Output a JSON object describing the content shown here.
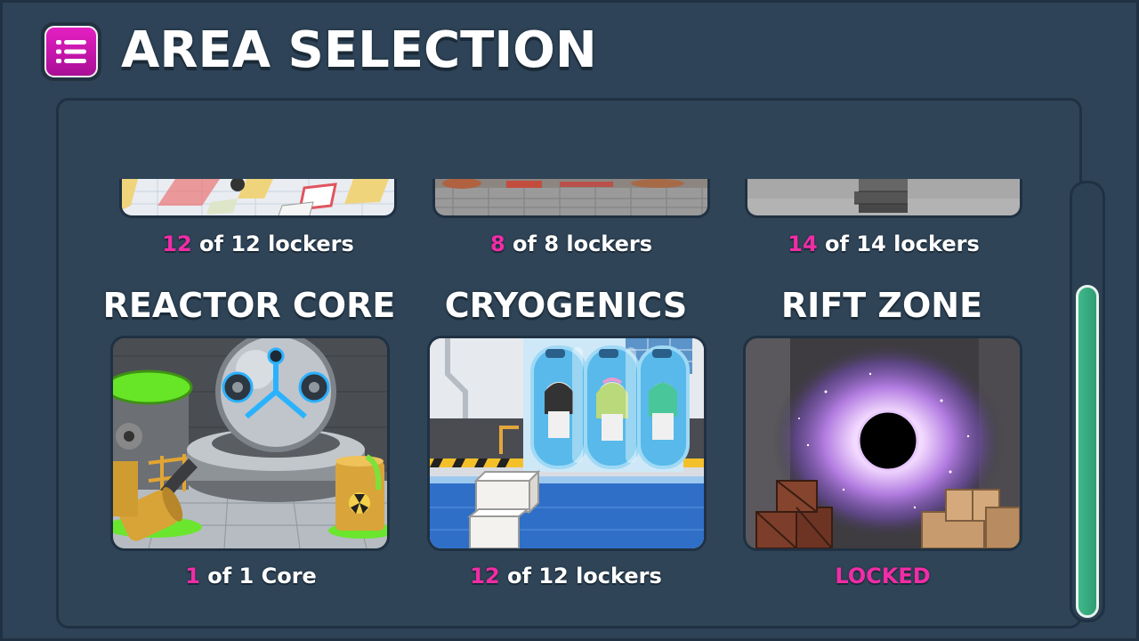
{
  "header": {
    "title": "AREA SELECTION",
    "menu_icon": "list-menu-icon"
  },
  "colors": {
    "background": "#2e4357",
    "accent_pink": "#f12ca6",
    "menu_button": "#d318b6",
    "scroll_thumb": "#3fb88a"
  },
  "partial_row": [
    {
      "count": "12",
      "suffix": " of 12 lockers"
    },
    {
      "count": "8",
      "suffix": " of 8 lockers"
    },
    {
      "count": "14",
      "suffix": " of 14 lockers"
    }
  ],
  "areas": [
    {
      "name": "REACTOR CORE",
      "count": "1",
      "suffix": " of 1 Core",
      "icon": "reactor-core-scene"
    },
    {
      "name": "CRYOGENICS",
      "count": "12",
      "suffix": " of 12 lockers",
      "icon": "cryogenics-scene"
    },
    {
      "name": "RIFT ZONE",
      "status": "LOCKED",
      "icon": "rift-zone-scene"
    }
  ],
  "scrollbar": {
    "position_fraction": 1.0
  }
}
